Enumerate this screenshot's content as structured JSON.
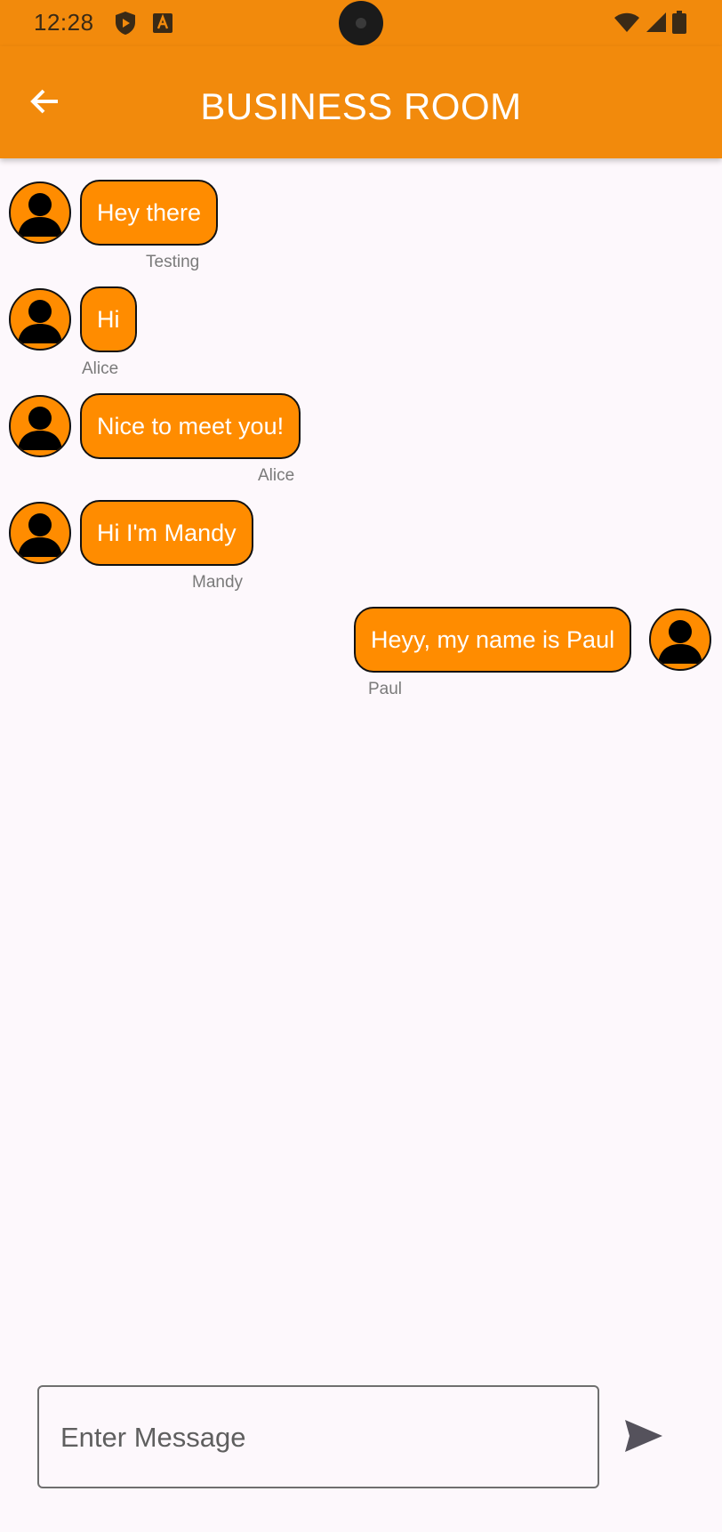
{
  "status_bar": {
    "time": "12:28",
    "left_icons": [
      "shield-play-icon",
      "font-a-icon"
    ],
    "right_icons": [
      "wifi-icon",
      "cellular-signal-icon",
      "battery-icon"
    ]
  },
  "app_bar": {
    "title": "BUSINESS ROOM",
    "back_icon": "arrow-left-icon"
  },
  "messages": [
    {
      "text": "Hey there",
      "sender": "Testing",
      "side": "left"
    },
    {
      "text": "Hi",
      "sender": "Alice",
      "side": "left"
    },
    {
      "text": "Nice to meet you!",
      "sender": "Alice",
      "side": "left"
    },
    {
      "text": "Hi I'm Mandy",
      "sender": "Mandy",
      "side": "left"
    },
    {
      "text": "Heyy, my name is Paul",
      "sender": "Paul",
      "side": "right"
    }
  ],
  "composer": {
    "placeholder": "Enter Message",
    "value": "",
    "send_icon": "send-icon"
  },
  "colors": {
    "accent": "#f28a0c",
    "bubble": "#ff8c00",
    "background": "#fdf8fc",
    "bubble_text": "#ffffff",
    "sender_text": "#7a7a7a"
  }
}
